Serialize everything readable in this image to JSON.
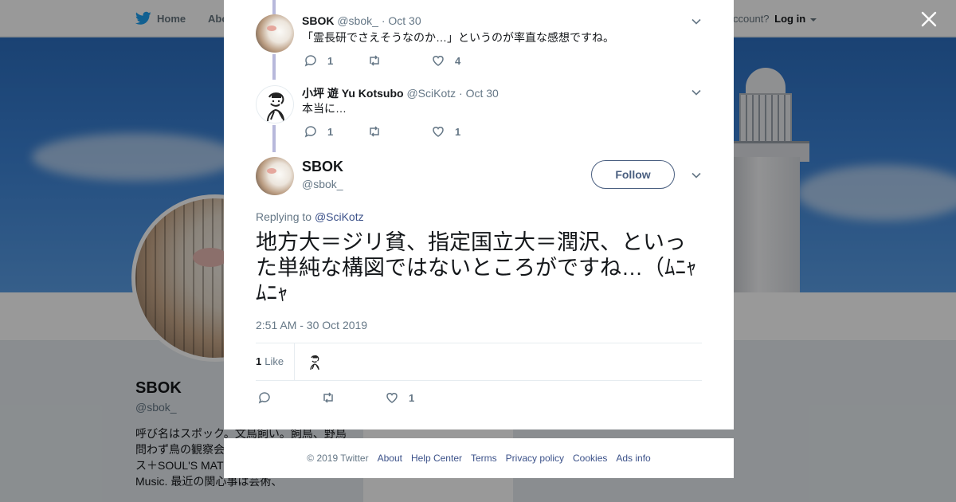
{
  "nav": {
    "home": "Home",
    "about": "Abo",
    "account_q": "ccount?",
    "login": "Log in"
  },
  "profile": {
    "name": "SBOK",
    "handle": "@sbok_",
    "bio": "呼び名はスポック。文鳥飼い。飼鳥、野鳥問わず鳥の観察会ほか国内外飼鳥レンジネス＋SOUL'S MATE。Birds, Pro-Wrestling, Music. 最近の関心事は芸術、"
  },
  "thread": [
    {
      "name": "SBOK",
      "handle": "@sbok_",
      "date": "Oct 30",
      "text": "「霊長研でさえそうなのか…」というのが率直な感想ですね。",
      "replies": "1",
      "retweets": "",
      "likes": "4"
    },
    {
      "name": "小坪 遊 Yu Kotsubo",
      "handle": "@SciKotz",
      "date": "Oct 30",
      "text": "本当に…",
      "replies": "1",
      "retweets": "",
      "likes": "1"
    }
  ],
  "main_tweet": {
    "name": "SBOK",
    "handle": "@sbok_",
    "follow": "Follow",
    "replying_prefix": "Replying to",
    "replying_to": "@SciKotz",
    "text": "地方大＝ジリ貧、指定国立大＝潤沢、といった単純な構図ではないところがですね…（ﾑﾆｬﾑﾆｬ",
    "timestamp": "2:51 AM - 30 Oct 2019",
    "like_count": "1",
    "like_label": "Like",
    "replies": "",
    "retweets": "",
    "likes": "1"
  },
  "footer": {
    "copyright": "© 2019 Twitter",
    "links": [
      "About",
      "Help Center",
      "Terms",
      "Privacy policy",
      "Cookies",
      "Ads info"
    ]
  },
  "colors": {
    "link": "#3b5189",
    "thread_line": "#b7b8db",
    "overlay": "rgba(0,0,0,0.40)"
  }
}
